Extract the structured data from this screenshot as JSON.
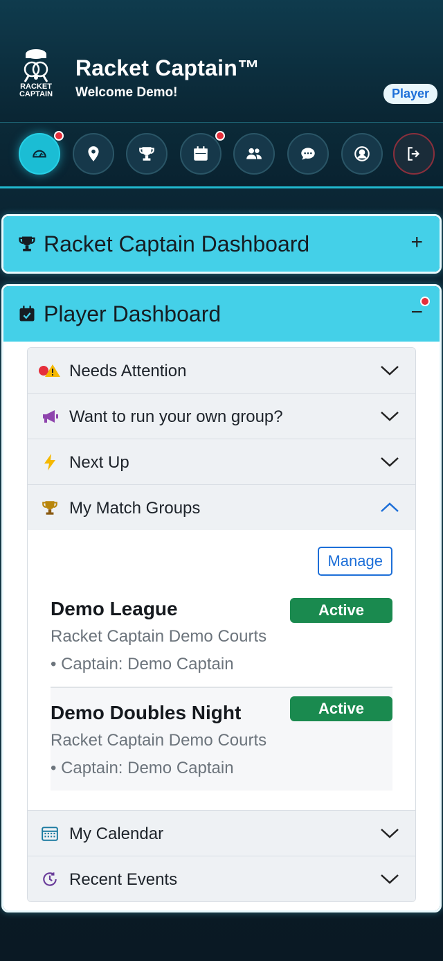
{
  "app": {
    "logo_text_line1": "RACKET",
    "logo_text_line2": "CAPTAIN",
    "title": "Racket Captain™",
    "welcome": "Welcome Demo!",
    "role_badge": "Player"
  },
  "nav": {
    "items": [
      {
        "name": "dashboard",
        "icon": "gauge-icon",
        "active": true,
        "notification": true
      },
      {
        "name": "locations",
        "icon": "map-pin-icon",
        "active": false,
        "notification": false
      },
      {
        "name": "groups",
        "icon": "trophy-icon",
        "active": false,
        "notification": false
      },
      {
        "name": "calendar",
        "icon": "calendar-icon",
        "active": false,
        "notification": true
      },
      {
        "name": "players",
        "icon": "people-icon",
        "active": false,
        "notification": false
      },
      {
        "name": "messages",
        "icon": "chat-icon",
        "active": false,
        "notification": false
      },
      {
        "name": "profile",
        "icon": "user-circle-icon",
        "active": false,
        "notification": false
      },
      {
        "name": "logout",
        "icon": "logout-icon",
        "active": false,
        "notification": false
      }
    ]
  },
  "captain_card": {
    "title": "Racket Captain Dashboard",
    "toggle": "+"
  },
  "player_card": {
    "title": "Player Dashboard",
    "toggle": "−",
    "sections": {
      "needs_attention": "Needs Attention",
      "run_group": "Want to run your own group?",
      "next_up": "Next Up",
      "match_groups": "My Match Groups",
      "calendar": "My Calendar",
      "recent_events": "Recent Events"
    },
    "match_groups": {
      "manage_label": "Manage",
      "groups": [
        {
          "name": "Demo League",
          "venue": "Racket Captain Demo Courts",
          "captain": "• Captain: Demo Captain",
          "status": "Active"
        },
        {
          "name": "Demo Doubles Night",
          "venue": "Racket Captain Demo Courts",
          "captain": "• Captain: Demo Captain",
          "status": "Active"
        }
      ]
    }
  },
  "colors": {
    "accent_cyan": "#44d0e8",
    "nav_active": "#1bbdd4",
    "status_active": "#1a8a4f",
    "link_blue": "#1d6fd8",
    "notification_red": "#e52f3b"
  }
}
